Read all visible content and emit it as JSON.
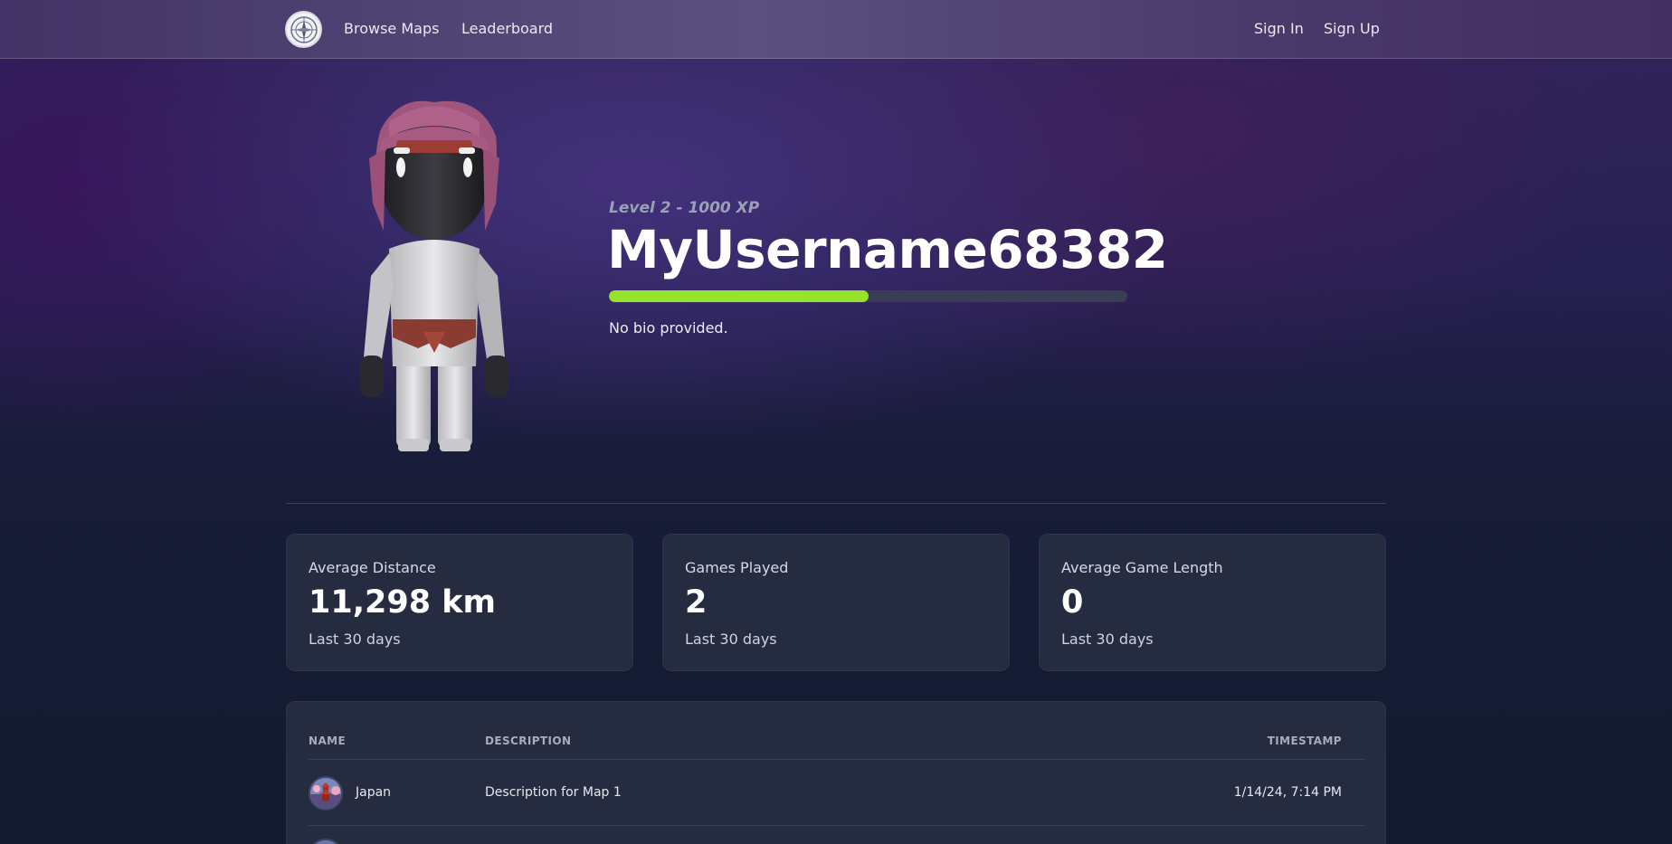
{
  "nav": {
    "links": [
      "Browse Maps",
      "Leaderboard"
    ],
    "auth": [
      "Sign In",
      "Sign Up"
    ],
    "logo_icon": "compass-globe-icon"
  },
  "profile": {
    "level_text": "Level 2 - 1000 XP",
    "username": "MyUsername68382",
    "xp_progress_fraction": 0.5,
    "bio": "No bio provided.",
    "avatar": "3d-character-avatar"
  },
  "stats": [
    {
      "label": "Average Distance",
      "value": "11,298 km",
      "sub": "Last 30 days"
    },
    {
      "label": "Games Played",
      "value": "2",
      "sub": "Last 30 days"
    },
    {
      "label": "Average Game Length",
      "value": "0",
      "sub": "Last 30 days"
    }
  ],
  "games_table": {
    "columns": [
      "NAME",
      "DESCRIPTION",
      "TIMESTAMP"
    ],
    "rows": [
      {
        "name": "Japan",
        "description": "Description for Map 1",
        "timestamp": "1/14/24, 7:14 PM"
      }
    ]
  },
  "colors": {
    "xp_bar": "#97e22a",
    "card_bg": "#262c40"
  }
}
